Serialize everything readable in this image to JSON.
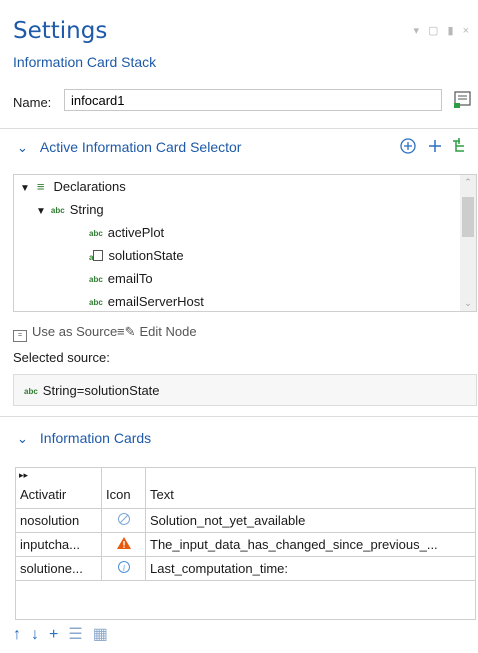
{
  "header": {
    "title": "Settings",
    "subtitle": "Information Card Stack",
    "window_controls": "▾ ▢ ▮ ×"
  },
  "name": {
    "label": "Name:",
    "value": "infocard1"
  },
  "selector_section": {
    "title": "Active Information Card Selector",
    "tree": {
      "root_label": "Declarations",
      "child_label": "String",
      "items": [
        {
          "label": "activePlot",
          "type_icon": "abc"
        },
        {
          "label": "solutionState",
          "type_icon": "abc-table"
        },
        {
          "label": "emailTo",
          "type_icon": "abc"
        },
        {
          "label": "emailServerHost",
          "type_icon": "abc"
        }
      ],
      "type_badge": "abc"
    },
    "use_as_source_label": "Use as Source",
    "edit_node_label": "Edit Node",
    "selected_source_label": "Selected source:",
    "selected_source_value": "String=solutionState"
  },
  "cards_section": {
    "title": "Information Cards",
    "table": {
      "headers": [
        "Activatir",
        "Icon",
        "Text"
      ],
      "rows": [
        {
          "activation": "nosolution",
          "icon": "circle-slash-icon",
          "text": "Solution_not_yet_available"
        },
        {
          "activation": "inputcha...",
          "icon": "warning-icon",
          "text": "The_input_data_has_changed_since_previous_..."
        },
        {
          "activation": "solutione...",
          "icon": "info-icon",
          "text": "Last_computation_time:"
        }
      ]
    }
  },
  "colors": {
    "accent": "#1e5aa8",
    "warning": "#e8590c",
    "info": "#4a90d9",
    "abc_green": "#2e7d32"
  }
}
